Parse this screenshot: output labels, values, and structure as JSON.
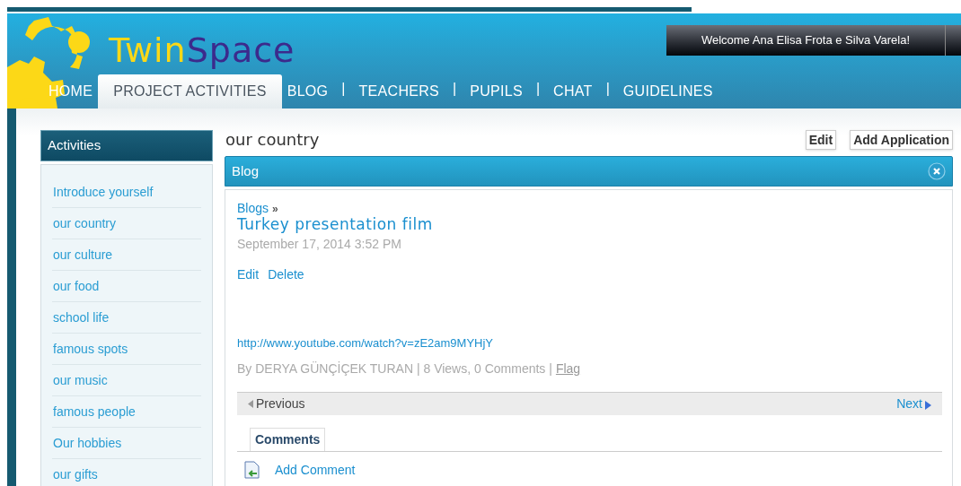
{
  "header": {
    "logo_first": "Twin",
    "logo_second": "Space",
    "welcome": "Welcome Ana Elisa Frota e Silva Varela!"
  },
  "nav": {
    "separator": "|",
    "items": [
      {
        "label": "HOME",
        "selected": false
      },
      {
        "label": "PROJECT ACTIVITIES",
        "selected": true
      },
      {
        "label": "BLOG",
        "selected": false
      },
      {
        "label": "TEACHERS",
        "selected": false
      },
      {
        "label": "PUPILS",
        "selected": false
      },
      {
        "label": "CHAT",
        "selected": false
      },
      {
        "label": "GUIDELINES",
        "selected": false
      }
    ]
  },
  "sidebar": {
    "title": "Activities",
    "items": [
      "Introduce yourself",
      "our country",
      "our culture",
      "our food",
      "school life",
      "famous spots",
      "our music",
      "famous people",
      "Our hobbies",
      "our gifts"
    ]
  },
  "page": {
    "title": "our country",
    "buttons": [
      "Edit",
      "Add Application"
    ]
  },
  "blog": {
    "panel_title": "Blog",
    "breadcrumb": "Blogs",
    "breadcrumb_sep": "»",
    "entry_title": "Turkey presentation film",
    "date": "September 17, 2014 3:52 PM",
    "actions": [
      "Edit",
      "Delete"
    ],
    "link": "http://www.youtube.com/watch?v=zE2am9MYHjY",
    "meta": "By DERYA GÜNÇİÇEK TURAN | 8 Views, 0 Comments |",
    "flag": "Flag",
    "previous": "Previous",
    "next": "Next",
    "comments_tab": "Comments",
    "add_comment": "Add Comment"
  }
}
